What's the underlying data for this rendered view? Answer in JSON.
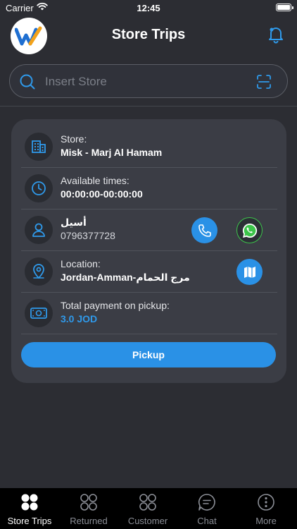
{
  "status_bar": {
    "carrier": "Carrier",
    "time": "12:45"
  },
  "header": {
    "title": "Store Trips",
    "logo_icon": "w-logo",
    "bell_icon": "bell-icon"
  },
  "search": {
    "placeholder": "Insert Store",
    "value": ""
  },
  "card": {
    "store": {
      "label": "Store:",
      "value": "Misk - Marj Al Hamam"
    },
    "times": {
      "label": "Available times:",
      "value": "00:00:00-00:00:00"
    },
    "contact": {
      "name": "أسيل",
      "phone": "0796377728"
    },
    "location": {
      "label": "Location:",
      "value": "Jordan-Amman-مرج الحمام"
    },
    "payment": {
      "label": "Total payment on pickup:",
      "value": "3.0 JOD"
    },
    "pickup_label": "Pickup"
  },
  "tabbar": {
    "items": [
      {
        "label": "Store Trips",
        "active": true
      },
      {
        "label": "Returned",
        "active": false
      },
      {
        "label": "Customer",
        "active": false
      },
      {
        "label": "Chat",
        "active": false
      },
      {
        "label": "More",
        "active": false
      }
    ]
  },
  "colors": {
    "accent": "#2a91e6",
    "background": "#2c2d33",
    "card": "#3b3d45",
    "whatsapp": "#3cc44a"
  }
}
